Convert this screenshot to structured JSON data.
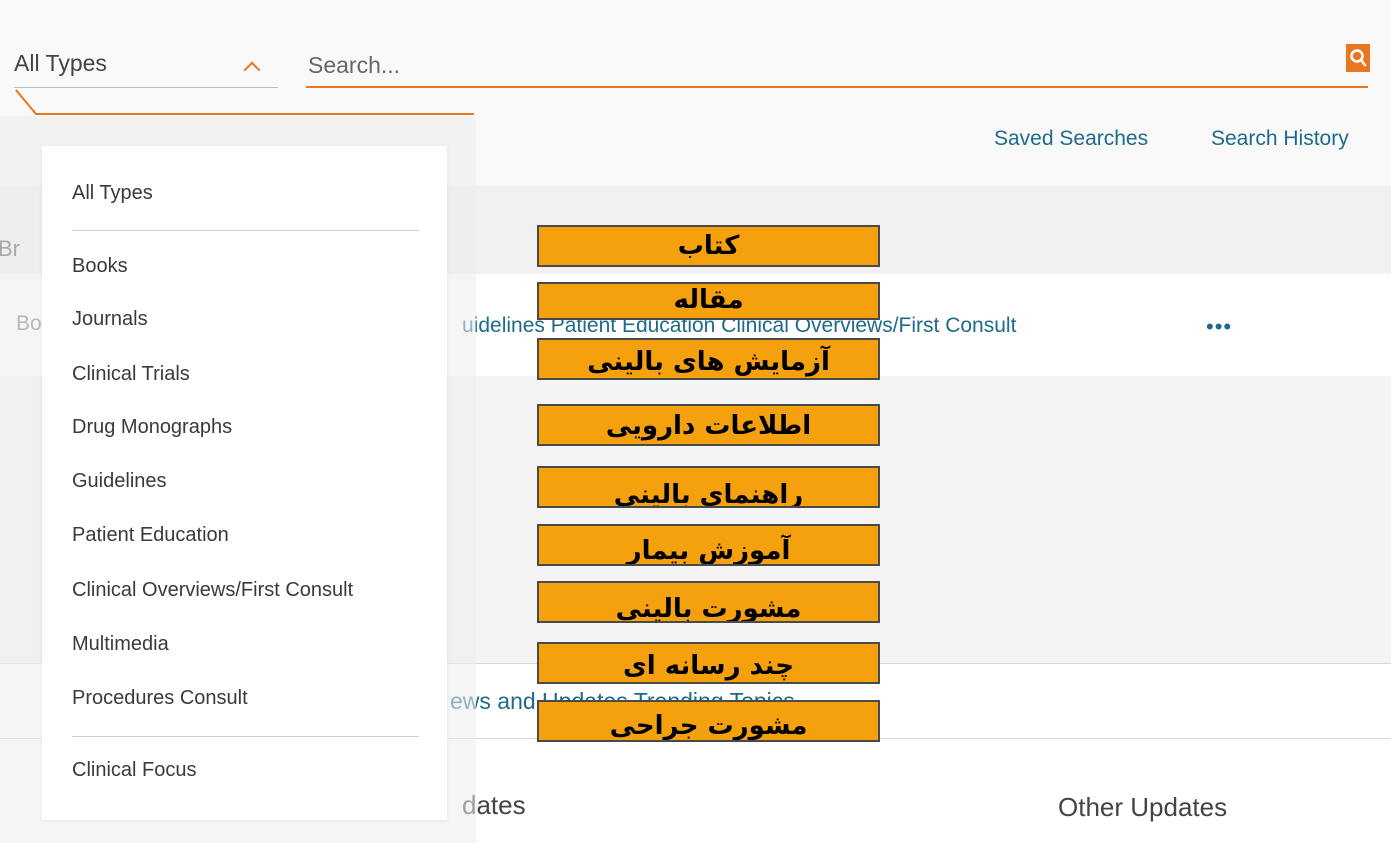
{
  "search": {
    "type_selected": "All Types",
    "placeholder": "Search..."
  },
  "links": {
    "saved_searches": "Saved Searches",
    "search_history": "Search History"
  },
  "background": {
    "browse_peek": "Br",
    "bo_peek": "Bo",
    "browse_links_peek": "uidelines   Patient Education   Clinical Overviews/First Consult",
    "more": "•••",
    "tabs_peek": "ews and Updates       Trending Topics",
    "updates_left_peek": "dates",
    "updates_right": "Other Updates"
  },
  "dropdown": {
    "items": [
      "All Types",
      "Books",
      "Journals",
      "Clinical Trials",
      "Drug Monographs",
      "Guidelines",
      "Patient Education",
      "Clinical Overviews/First Consult",
      "Multimedia",
      "Procedures Consult",
      "Clinical Focus"
    ]
  },
  "annotations": [
    "کتاب",
    "مقاله",
    "آزمایش های بالینی",
    "اطلاعات دارویی",
    "راهنمای بالینی",
    "آموزش بیمار",
    "مشورت بالینی",
    "چند رسانه ای",
    "مشورت جراحی"
  ],
  "colors": {
    "accent": "#e87722",
    "link": "#1f6a8a",
    "annotation_fill": "#f5a00d"
  },
  "icons": {
    "search": "search-icon",
    "chevron": "chevron-up-icon",
    "more": "more-dots-icon"
  }
}
